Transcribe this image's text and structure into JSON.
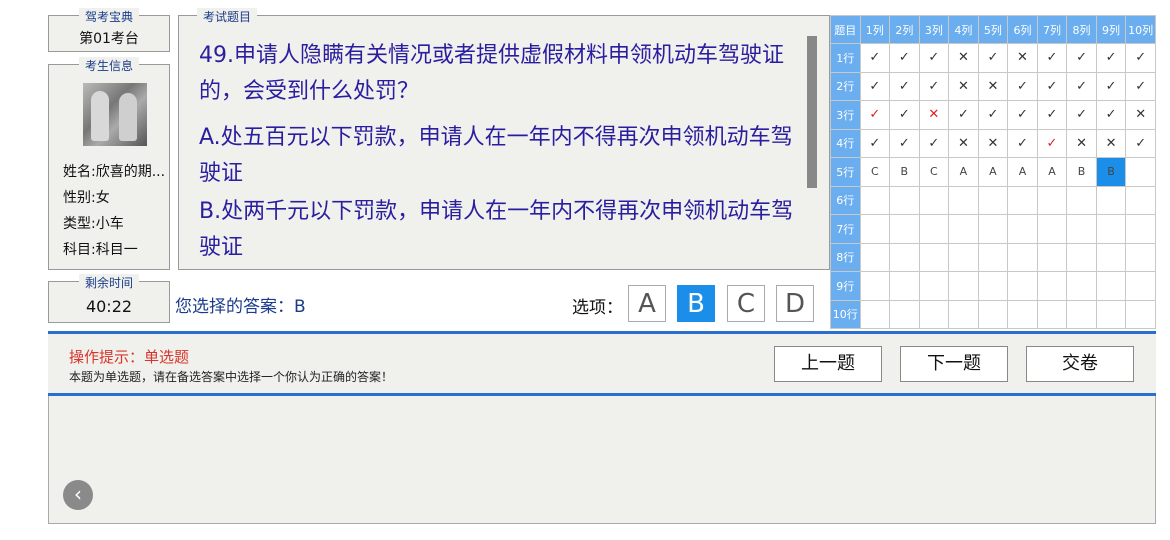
{
  "exam_seat": {
    "legend": "驾考宝典",
    "value": "第01考台"
  },
  "candidate": {
    "legend": "考生信息",
    "name": "姓名:欣喜的期...",
    "gender": "性别:女",
    "type": "类型:小车",
    "subject": "科目:科目一"
  },
  "timer": {
    "legend": "剩余时间",
    "value": "40:22"
  },
  "question": {
    "legend": "考试题目",
    "text": "49.申请人隐瞒有关情况或者提供虚假材料申领机动车驾驶证的，会受到什么处罚？",
    "option_a": "A.处五百元以下罚款，申请人在一年内不得再次申领机动车驾驶证",
    "option_b": "B.处两千元以下罚款，申请人在一年内不得再次申领机动车驾驶证"
  },
  "answer": {
    "text": "您选择的答案：B"
  },
  "options": {
    "label": "选项：",
    "items": [
      "A",
      "B",
      "C",
      "D"
    ],
    "selected": "B"
  },
  "grid": {
    "corner": "题目",
    "cols": [
      "1列",
      "2列",
      "3列",
      "4列",
      "5列",
      "6列",
      "7列",
      "8列",
      "9列",
      "10列"
    ],
    "rows": [
      "1行",
      "2行",
      "3行",
      "4行",
      "5行",
      "6行",
      "7行",
      "8行",
      "9行",
      "10行"
    ],
    "cells": [
      [
        "✓",
        "✓",
        "✓",
        "✕",
        "✓",
        "✕",
        "✓",
        "✓",
        "✓",
        "✓"
      ],
      [
        "✓",
        "✓",
        "✓",
        "✕",
        "✕",
        "✓",
        "✓",
        "✓",
        "✓",
        "✓"
      ],
      [
        "✓",
        "✓",
        "✕",
        "✓",
        "✓",
        "✓",
        "✓",
        "✓",
        "✓",
        "✕"
      ],
      [
        "✓",
        "✓",
        "✓",
        "✕",
        "✕",
        "✓",
        "✓",
        "✕",
        "✕",
        "✓"
      ],
      [
        "C",
        "B",
        "C",
        "A",
        "A",
        "A",
        "A",
        "B",
        "B",
        ""
      ],
      [
        "",
        "",
        "",
        "",
        "",
        "",
        "",
        "",
        "",
        ""
      ],
      [
        "",
        "",
        "",
        "",
        "",
        "",
        "",
        "",
        "",
        ""
      ],
      [
        "",
        "",
        "",
        "",
        "",
        "",
        "",
        "",
        "",
        ""
      ],
      [
        "",
        "",
        "",
        "",
        "",
        "",
        "",
        "",
        "",
        ""
      ],
      [
        "",
        "",
        "",
        "",
        "",
        "",
        "",
        "",
        "",
        ""
      ]
    ],
    "red_cells": [
      [
        2,
        0
      ],
      [
        2,
        2
      ],
      [
        3,
        6
      ]
    ],
    "current_cell": [
      4,
      8
    ]
  },
  "tips": {
    "title": "操作提示：单选题",
    "body": "本题为单选题，请在备选答案中选择一个你认为正确的答案！"
  },
  "actions": {
    "prev": "上一题",
    "next": "下一题",
    "submit": "交卷"
  },
  "back_icon": "chevron-left-icon",
  "colors": {
    "accent": "#1a8ee8",
    "header": "#6aaef0",
    "question_text": "#2a1ea0",
    "tip_title": "#d9342b"
  }
}
